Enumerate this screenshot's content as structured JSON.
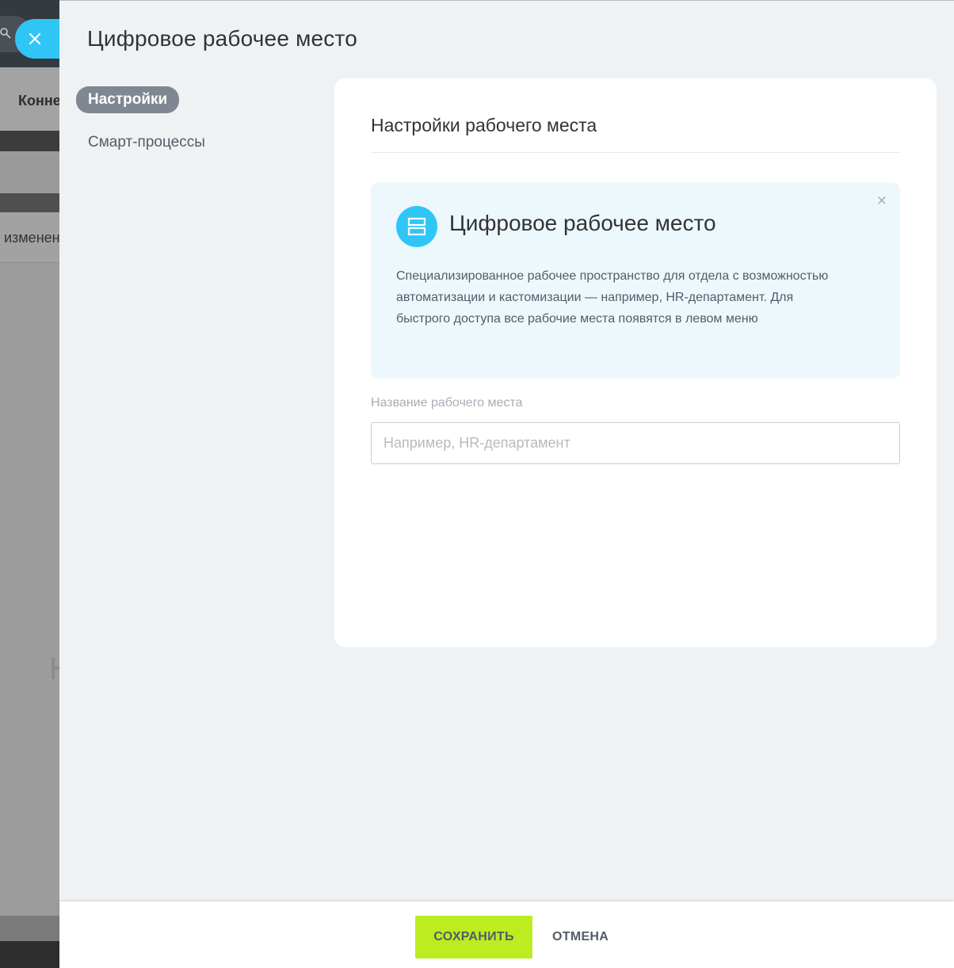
{
  "background": {
    "header_text": "Конне",
    "row_text": "изменен",
    "big_letter": "Н"
  },
  "slider": {
    "title": "Цифровое рабочее место",
    "menu": {
      "items": [
        {
          "label": "Настройки",
          "active": true
        },
        {
          "label": "Смарт-процессы",
          "active": false
        }
      ]
    },
    "card": {
      "title": "Настройки рабочего места",
      "info": {
        "heading": "Цифровое рабочее место",
        "text": "Специализированное рабочее пространство для отдела с возможностью автоматизации и кастомизации — например, HR-департамент. Для быстрого доступа все рабочие места появятся в левом меню",
        "close": "×"
      },
      "name_field": {
        "label": "Название рабочего места",
        "value": "",
        "placeholder": "Например, HR-департамент"
      }
    },
    "footer": {
      "save_label": "СОХРАНИТЬ",
      "cancel_label": "ОТМЕНА"
    }
  },
  "colors": {
    "accent": "#2fc6f6",
    "save_button": "#bbed21",
    "active_menu": "#7f8792",
    "slider_bg": "#eef2f4",
    "info_bg": "#edf8fc"
  }
}
